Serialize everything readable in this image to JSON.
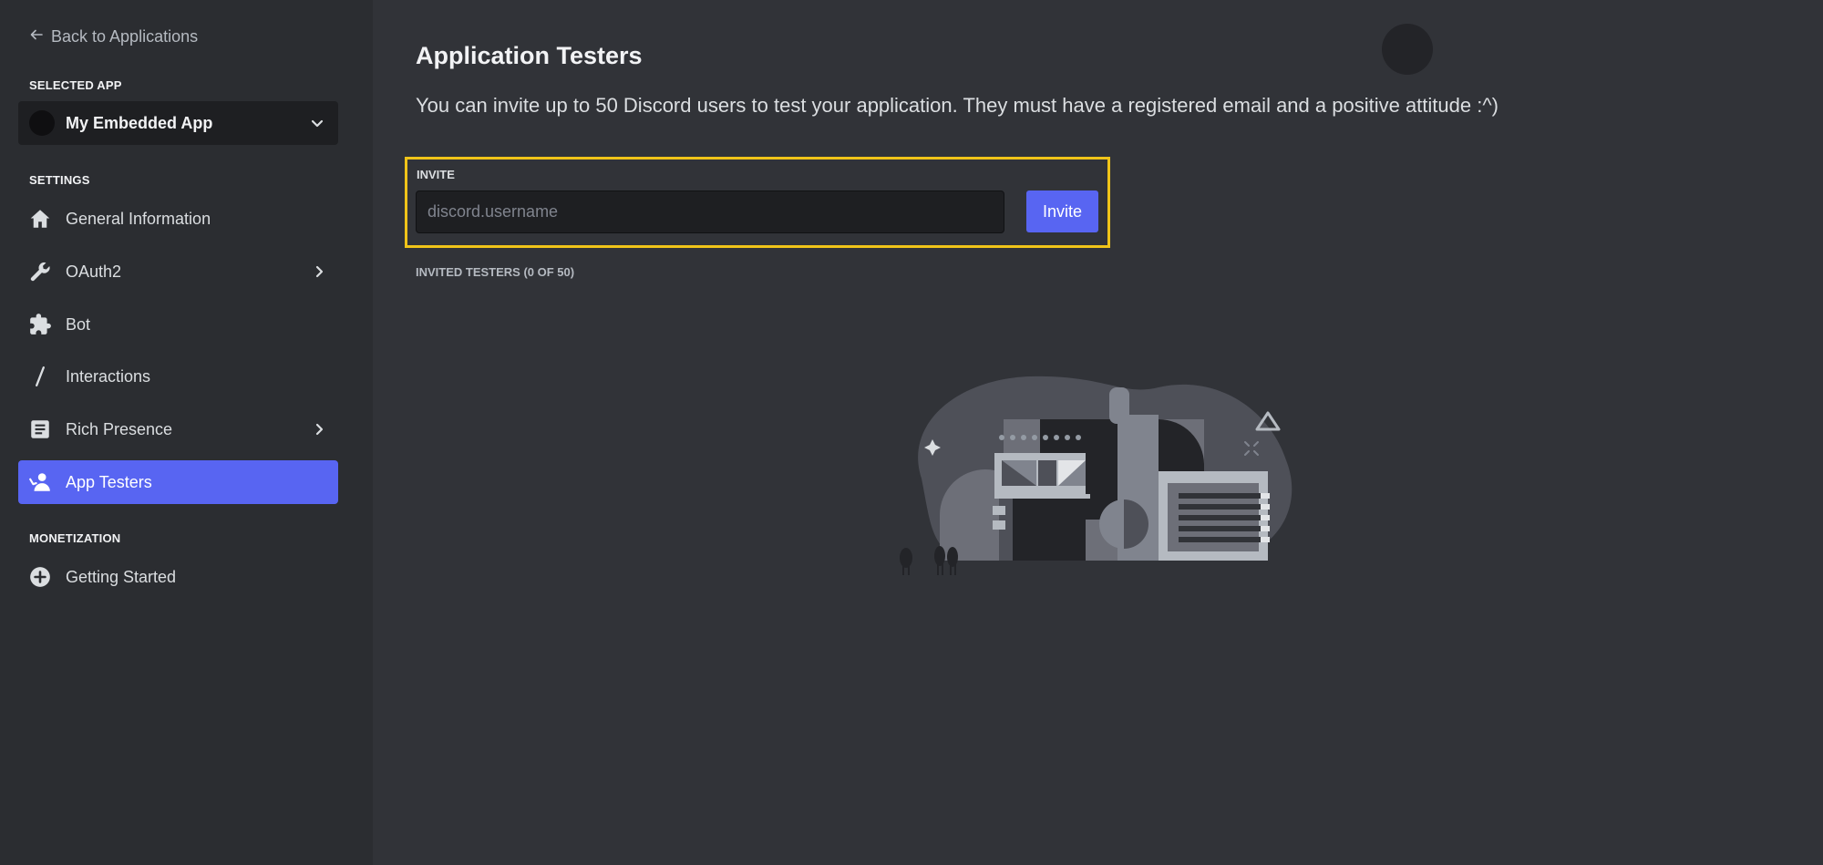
{
  "sidebar": {
    "back_label": "Back to Applications",
    "selected_app_heading": "SELECTED APP",
    "selected_app_name": "My Embedded App",
    "settings_heading": "SETTINGS",
    "items": [
      {
        "label": "General Information",
        "icon": "home-icon"
      },
      {
        "label": "OAuth2",
        "icon": "wrench-icon",
        "has_submenu": true
      },
      {
        "label": "Bot",
        "icon": "puzzle-icon"
      },
      {
        "label": "Interactions",
        "icon": "slash-icon"
      },
      {
        "label": "Rich Presence",
        "icon": "document-icon",
        "has_submenu": true
      },
      {
        "label": "App Testers",
        "icon": "person-wave-icon",
        "active": true
      }
    ],
    "monetization_heading": "MONETIZATION",
    "monetization_items": [
      {
        "label": "Getting Started",
        "icon": "plus-circle-icon"
      }
    ]
  },
  "main": {
    "title": "Application Testers",
    "description": "You can invite up to 50 Discord users to test your application. They must have a registered email and a positive attitude :^)",
    "invite": {
      "label": "INVITE",
      "placeholder": "discord.username",
      "value": "",
      "button_label": "Invite"
    },
    "invited_heading": "INVITED TESTERS (0 OF 50)"
  },
  "colors": {
    "accent": "#5865f2",
    "highlight_border": "#f0c419",
    "sidebar_bg": "#2b2d31",
    "main_bg": "#313338"
  }
}
